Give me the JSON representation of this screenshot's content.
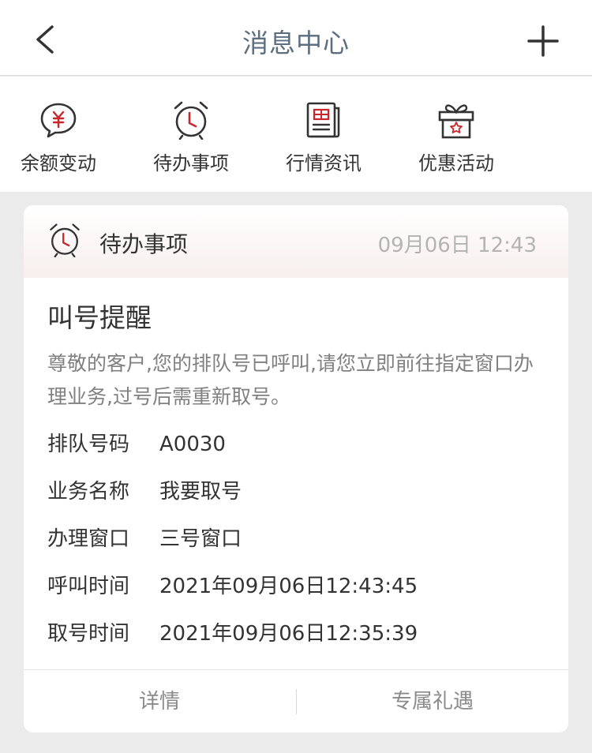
{
  "navbar": {
    "title": "消息中心",
    "back_icon": "chevron-left-icon",
    "add_icon": "plus-icon"
  },
  "categories": [
    {
      "label": "余额变动",
      "icon": "yuan-chat-icon"
    },
    {
      "label": "待办事项",
      "icon": "alarm-clock-icon"
    },
    {
      "label": "行情资讯",
      "icon": "newspaper-icon"
    },
    {
      "label": "优惠活动",
      "icon": "gift-icon"
    }
  ],
  "card": {
    "category": "待办事项",
    "time": "09月06日 12:43",
    "title": "叫号提醒",
    "body": "尊敬的客户,您的排队号已呼叫,请您立即前往指定窗口办理业务,过号后需重新取号。",
    "fields": [
      {
        "key": "排队号码",
        "value": "A0030"
      },
      {
        "key": "业务名称",
        "value": "我要取号"
      },
      {
        "key": "办理窗口",
        "value": "三号窗口"
      },
      {
        "key": "呼叫时间",
        "value": "2021年09月06日12:43:45"
      },
      {
        "key": "取号时间",
        "value": "2021年09月06日12:35:39"
      }
    ],
    "actions": {
      "detail": "详情",
      "perks": "专属礼遇"
    }
  },
  "colors": {
    "accent_red": "#c8262b",
    "title_gray_blue": "#5c6f80",
    "background": "#ebebeb"
  }
}
